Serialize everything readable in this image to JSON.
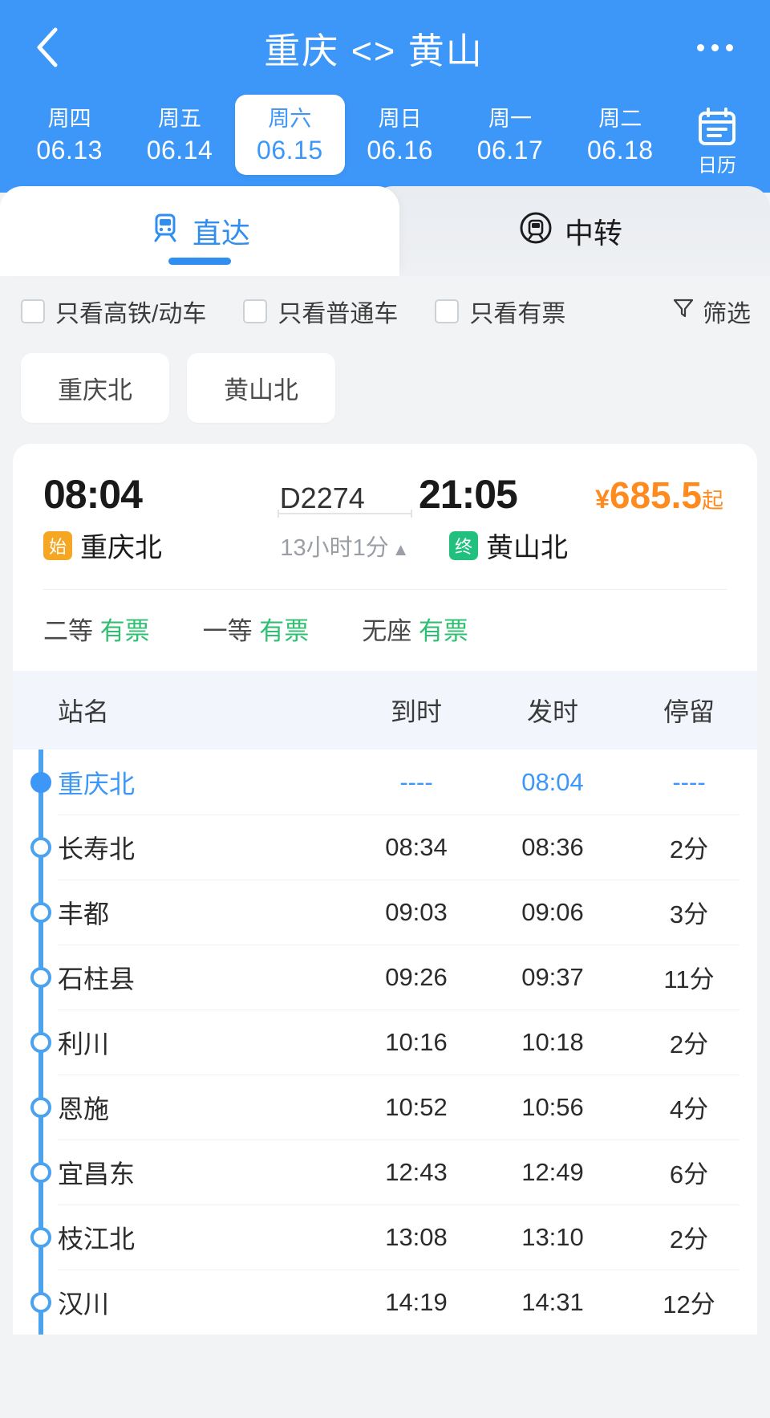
{
  "header": {
    "back_icon": "chevron-left-icon",
    "title": "重庆 <> 黄山",
    "more_icon": "more-horizontal-icon",
    "calendar": {
      "icon": "calendar-icon",
      "label": "日历"
    },
    "dates": [
      {
        "dow": "周四",
        "date": "06.13",
        "active": false
      },
      {
        "dow": "周五",
        "date": "06.14",
        "active": false
      },
      {
        "dow": "周六",
        "date": "06.15",
        "active": true
      },
      {
        "dow": "周日",
        "date": "06.16",
        "active": false
      },
      {
        "dow": "周一",
        "date": "06.17",
        "active": false
      },
      {
        "dow": "周二",
        "date": "06.18",
        "active": false
      }
    ]
  },
  "tabs": [
    {
      "label": "直达",
      "icon": "train-icon",
      "active": true
    },
    {
      "label": "中转",
      "icon": "transfer-train-icon",
      "active": false
    }
  ],
  "filters": [
    {
      "label": "只看高铁/动车",
      "checked": false
    },
    {
      "label": "只看普通车",
      "checked": false
    },
    {
      "label": "只看有票",
      "checked": false
    }
  ],
  "sort": {
    "label": "筛选",
    "icon": "filter-icon"
  },
  "station_chips": [
    "重庆北",
    "黄山北"
  ],
  "train": {
    "depart_time": "08:04",
    "arrive_time": "21:05",
    "train_no": "D2274",
    "price_currency": "¥",
    "price_value": "685.5",
    "price_suffix": "起",
    "depart_station": "重庆北",
    "depart_badge": "始",
    "arrive_station": "黄山北",
    "arrive_badge": "终",
    "duration": "13小时1分",
    "duration_caret": "▲",
    "seats": [
      {
        "cls": "二等",
        "status": "有票"
      },
      {
        "cls": "一等",
        "status": "有票"
      },
      {
        "cls": "无座",
        "status": "有票"
      }
    ]
  },
  "timetable": {
    "columns": [
      "站名",
      "到时",
      "发时",
      "停留"
    ],
    "rows": [
      {
        "station": "重庆北",
        "arrive": "----",
        "depart": "08:04",
        "stop": "----",
        "first": true
      },
      {
        "station": "长寿北",
        "arrive": "08:34",
        "depart": "08:36",
        "stop": "2分",
        "first": false
      },
      {
        "station": "丰都",
        "arrive": "09:03",
        "depart": "09:06",
        "stop": "3分",
        "first": false
      },
      {
        "station": "石柱县",
        "arrive": "09:26",
        "depart": "09:37",
        "stop": "11分",
        "first": false
      },
      {
        "station": "利川",
        "arrive": "10:16",
        "depart": "10:18",
        "stop": "2分",
        "first": false
      },
      {
        "station": "恩施",
        "arrive": "10:52",
        "depart": "10:56",
        "stop": "4分",
        "first": false
      },
      {
        "station": "宜昌东",
        "arrive": "12:43",
        "depart": "12:49",
        "stop": "6分",
        "first": false
      },
      {
        "station": "枝江北",
        "arrive": "13:08",
        "depart": "13:10",
        "stop": "2分",
        "first": false
      },
      {
        "station": "汉川",
        "arrive": "14:19",
        "depart": "14:31",
        "stop": "12分",
        "first": false
      }
    ]
  },
  "colors": {
    "brand_blue": "#3d97f8",
    "price_orange": "#ff8a1e",
    "seat_green": "#2fbf71",
    "badge_start": "#f5a623",
    "badge_end": "#22c07f"
  }
}
